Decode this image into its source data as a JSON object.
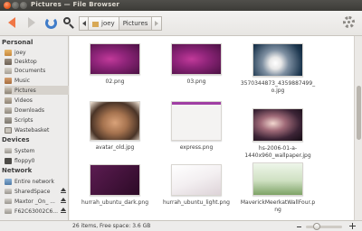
{
  "window": {
    "title": "Pictures — File Browser"
  },
  "toolbar": {
    "back_icon": "back-arrow-icon",
    "forward_icon": "forward-arrow-icon",
    "reload_icon": "reload-icon",
    "search_icon": "search-icon",
    "settings_icon": "gear-icon",
    "breadcrumbs": [
      "joey",
      "Pictures"
    ]
  },
  "sidebar": {
    "personal": {
      "heading": "Personal",
      "items": [
        {
          "label": "joey",
          "icon": "home-folder-icon"
        },
        {
          "label": "Desktop",
          "icon": "desktop-folder-icon"
        },
        {
          "label": "Documents",
          "icon": "documents-folder-icon"
        },
        {
          "label": "Music",
          "icon": "music-folder-icon"
        },
        {
          "label": "Pictures",
          "icon": "pictures-folder-icon",
          "selected": true
        },
        {
          "label": "Videos",
          "icon": "videos-folder-icon"
        },
        {
          "label": "Downloads",
          "icon": "downloads-folder-icon"
        },
        {
          "label": "Scripts",
          "icon": "folder-icon"
        },
        {
          "label": "Wastebasket",
          "icon": "trash-icon"
        }
      ]
    },
    "devices": {
      "heading": "Devices",
      "items": [
        {
          "label": "System",
          "icon": "drive-icon"
        },
        {
          "label": "floppy0",
          "icon": "floppy-icon"
        }
      ]
    },
    "network": {
      "heading": "Network",
      "items": [
        {
          "label": "Entire network",
          "icon": "network-icon"
        },
        {
          "label": "SharedSpace",
          "icon": "network-drive-icon",
          "eject": true
        },
        {
          "label": "Maxtor _On_ ...",
          "icon": "network-drive-icon",
          "eject": true
        },
        {
          "label": "F62C63002C6...",
          "icon": "drive-icon",
          "eject": true
        }
      ]
    }
  },
  "files": [
    {
      "name": "02.png"
    },
    {
      "name": "03.png"
    },
    {
      "name": "3570344873_4359887499_o.jpg"
    },
    {
      "name": "avatar_old.jpg"
    },
    {
      "name": "express.png"
    },
    {
      "name": "hs-2006-01-a-1440x960_wallpaper.jpg"
    },
    {
      "name": "hurrah_ubuntu_dark.png"
    },
    {
      "name": "hurrah_ubuntu_light.png"
    },
    {
      "name": "MaverickMeerkatWallFour.png"
    }
  ],
  "status": {
    "text": "26 items, Free space: 3.6 GB"
  },
  "colors": {
    "accent": "#f07746",
    "titlebar": "#3c3b37",
    "selection": "#d6d2cc"
  }
}
